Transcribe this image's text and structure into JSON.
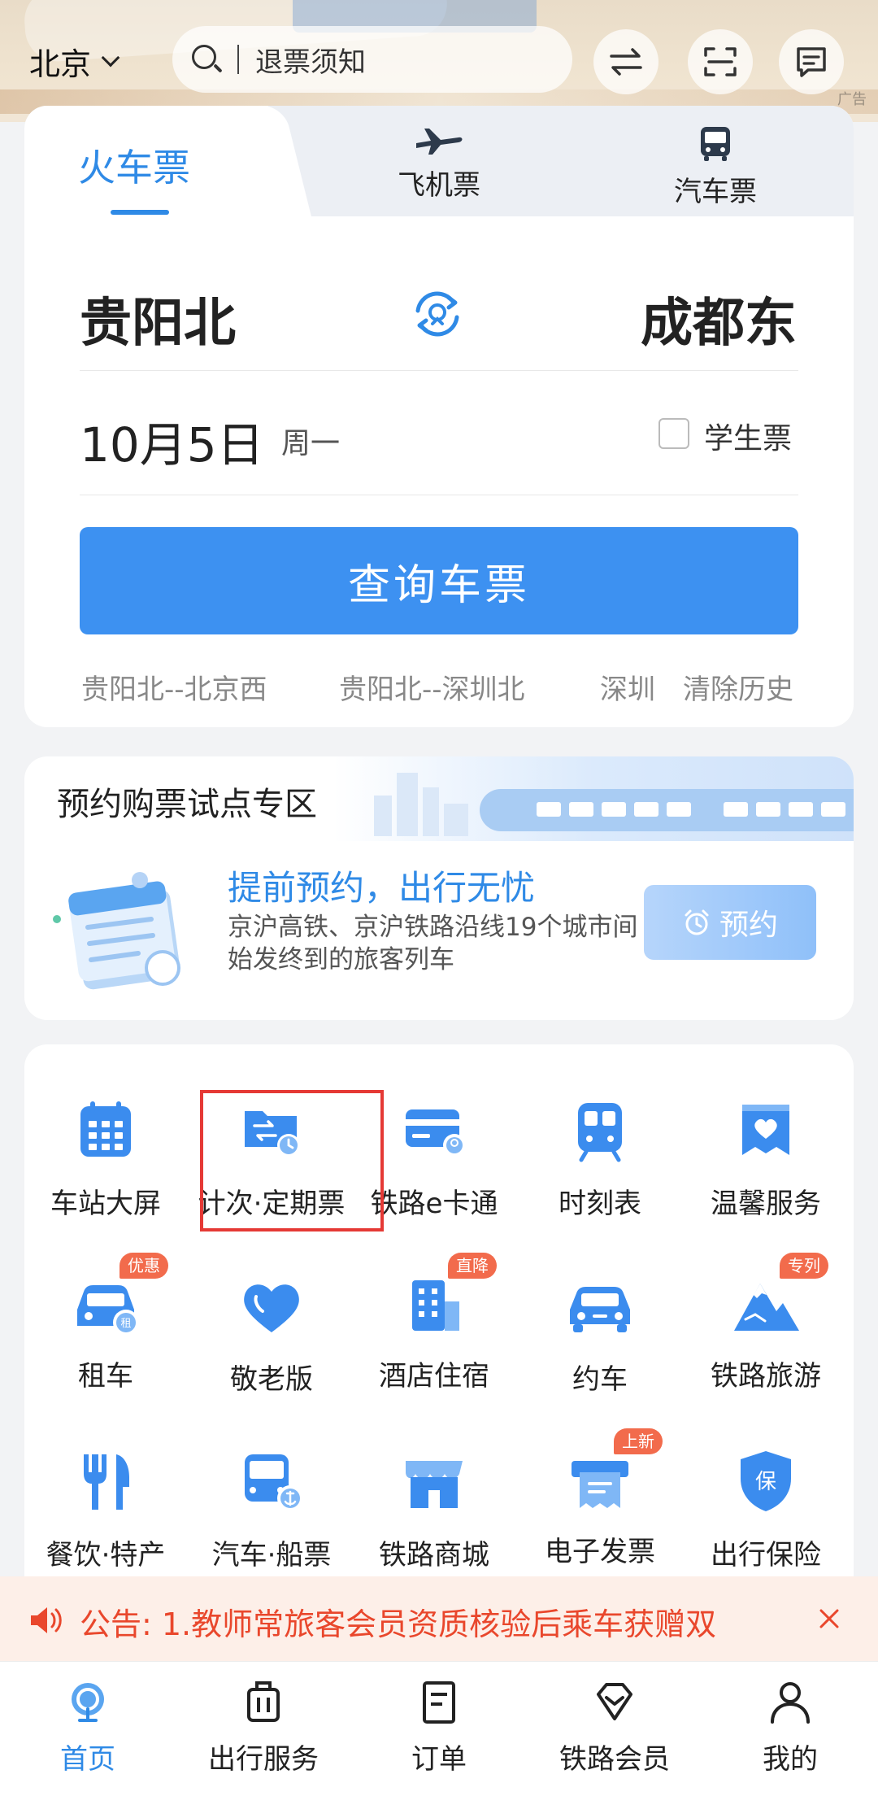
{
  "colors": {
    "accent": "#2f8ae6",
    "primary_button": "#3d91f1",
    "badge": "#f26b4c",
    "notice_text": "#e9472c",
    "highlight": "#e53935"
  },
  "banner": {
    "ad_label": "广告"
  },
  "header": {
    "city": "北京",
    "search_text": "退票须知",
    "icons": [
      "swap-icon",
      "scan-icon",
      "message-icon"
    ]
  },
  "ticket_tabs": {
    "train": "火车票",
    "flight": "飞机票",
    "bus": "汽车票"
  },
  "search_form": {
    "from_station": "贵阳北",
    "to_station": "成都东",
    "date": "10月5日",
    "weekday": "周一",
    "student_label": "学生票",
    "student_checked": false,
    "query_button": "查询车票",
    "history": [
      "贵阳北--北京西",
      "贵阳北--深圳北",
      "深圳:"
    ],
    "clear_history": "清除历史"
  },
  "reservation": {
    "title": "预约购票试点专区",
    "slogan": "提前预约，出行无忧",
    "description": "京沪高铁、京沪铁路沿线19个城市间始发终到的旅客列车",
    "button": "预约"
  },
  "services": [
    {
      "label": "车站大屏",
      "icon": "calendar-grid-icon",
      "badge": ""
    },
    {
      "label": "计次·定期票",
      "icon": "ticket-clock-icon",
      "badge": ""
    },
    {
      "label": "铁路e卡通",
      "icon": "card-icon",
      "badge": ""
    },
    {
      "label": "时刻表",
      "icon": "train-front-icon",
      "badge": ""
    },
    {
      "label": "温馨服务",
      "icon": "heart-box-icon",
      "badge": ""
    },
    {
      "label": "租车",
      "icon": "car-rent-icon",
      "badge": "优惠"
    },
    {
      "label": "敬老版",
      "icon": "heart-icon",
      "badge": ""
    },
    {
      "label": "酒店住宿",
      "icon": "hotel-icon",
      "badge": "直降"
    },
    {
      "label": "约车",
      "icon": "car-icon",
      "badge": ""
    },
    {
      "label": "铁路旅游",
      "icon": "mountain-icon",
      "badge": "专列"
    },
    {
      "label": "餐饮·特产",
      "icon": "fork-knife-icon",
      "badge": ""
    },
    {
      "label": "汽车·船票",
      "icon": "bus-anchor-icon",
      "badge": ""
    },
    {
      "label": "铁路商城",
      "icon": "shop-icon",
      "badge": ""
    },
    {
      "label": "电子发票",
      "icon": "invoice-icon",
      "badge": "上新"
    },
    {
      "label": "出行保险",
      "icon": "shield-icon",
      "badge": ""
    }
  ],
  "notice": {
    "text": "公告: 1.教师常旅客会员资质核验后乘车获赠双"
  },
  "bottom_nav": [
    {
      "label": "首页",
      "icon": "home-icon",
      "active": true
    },
    {
      "label": "出行服务",
      "icon": "luggage-icon",
      "active": false
    },
    {
      "label": "订单",
      "icon": "order-icon",
      "active": false
    },
    {
      "label": "铁路会员",
      "icon": "diamond-icon",
      "active": false
    },
    {
      "label": "我的",
      "icon": "user-icon",
      "active": false
    }
  ]
}
